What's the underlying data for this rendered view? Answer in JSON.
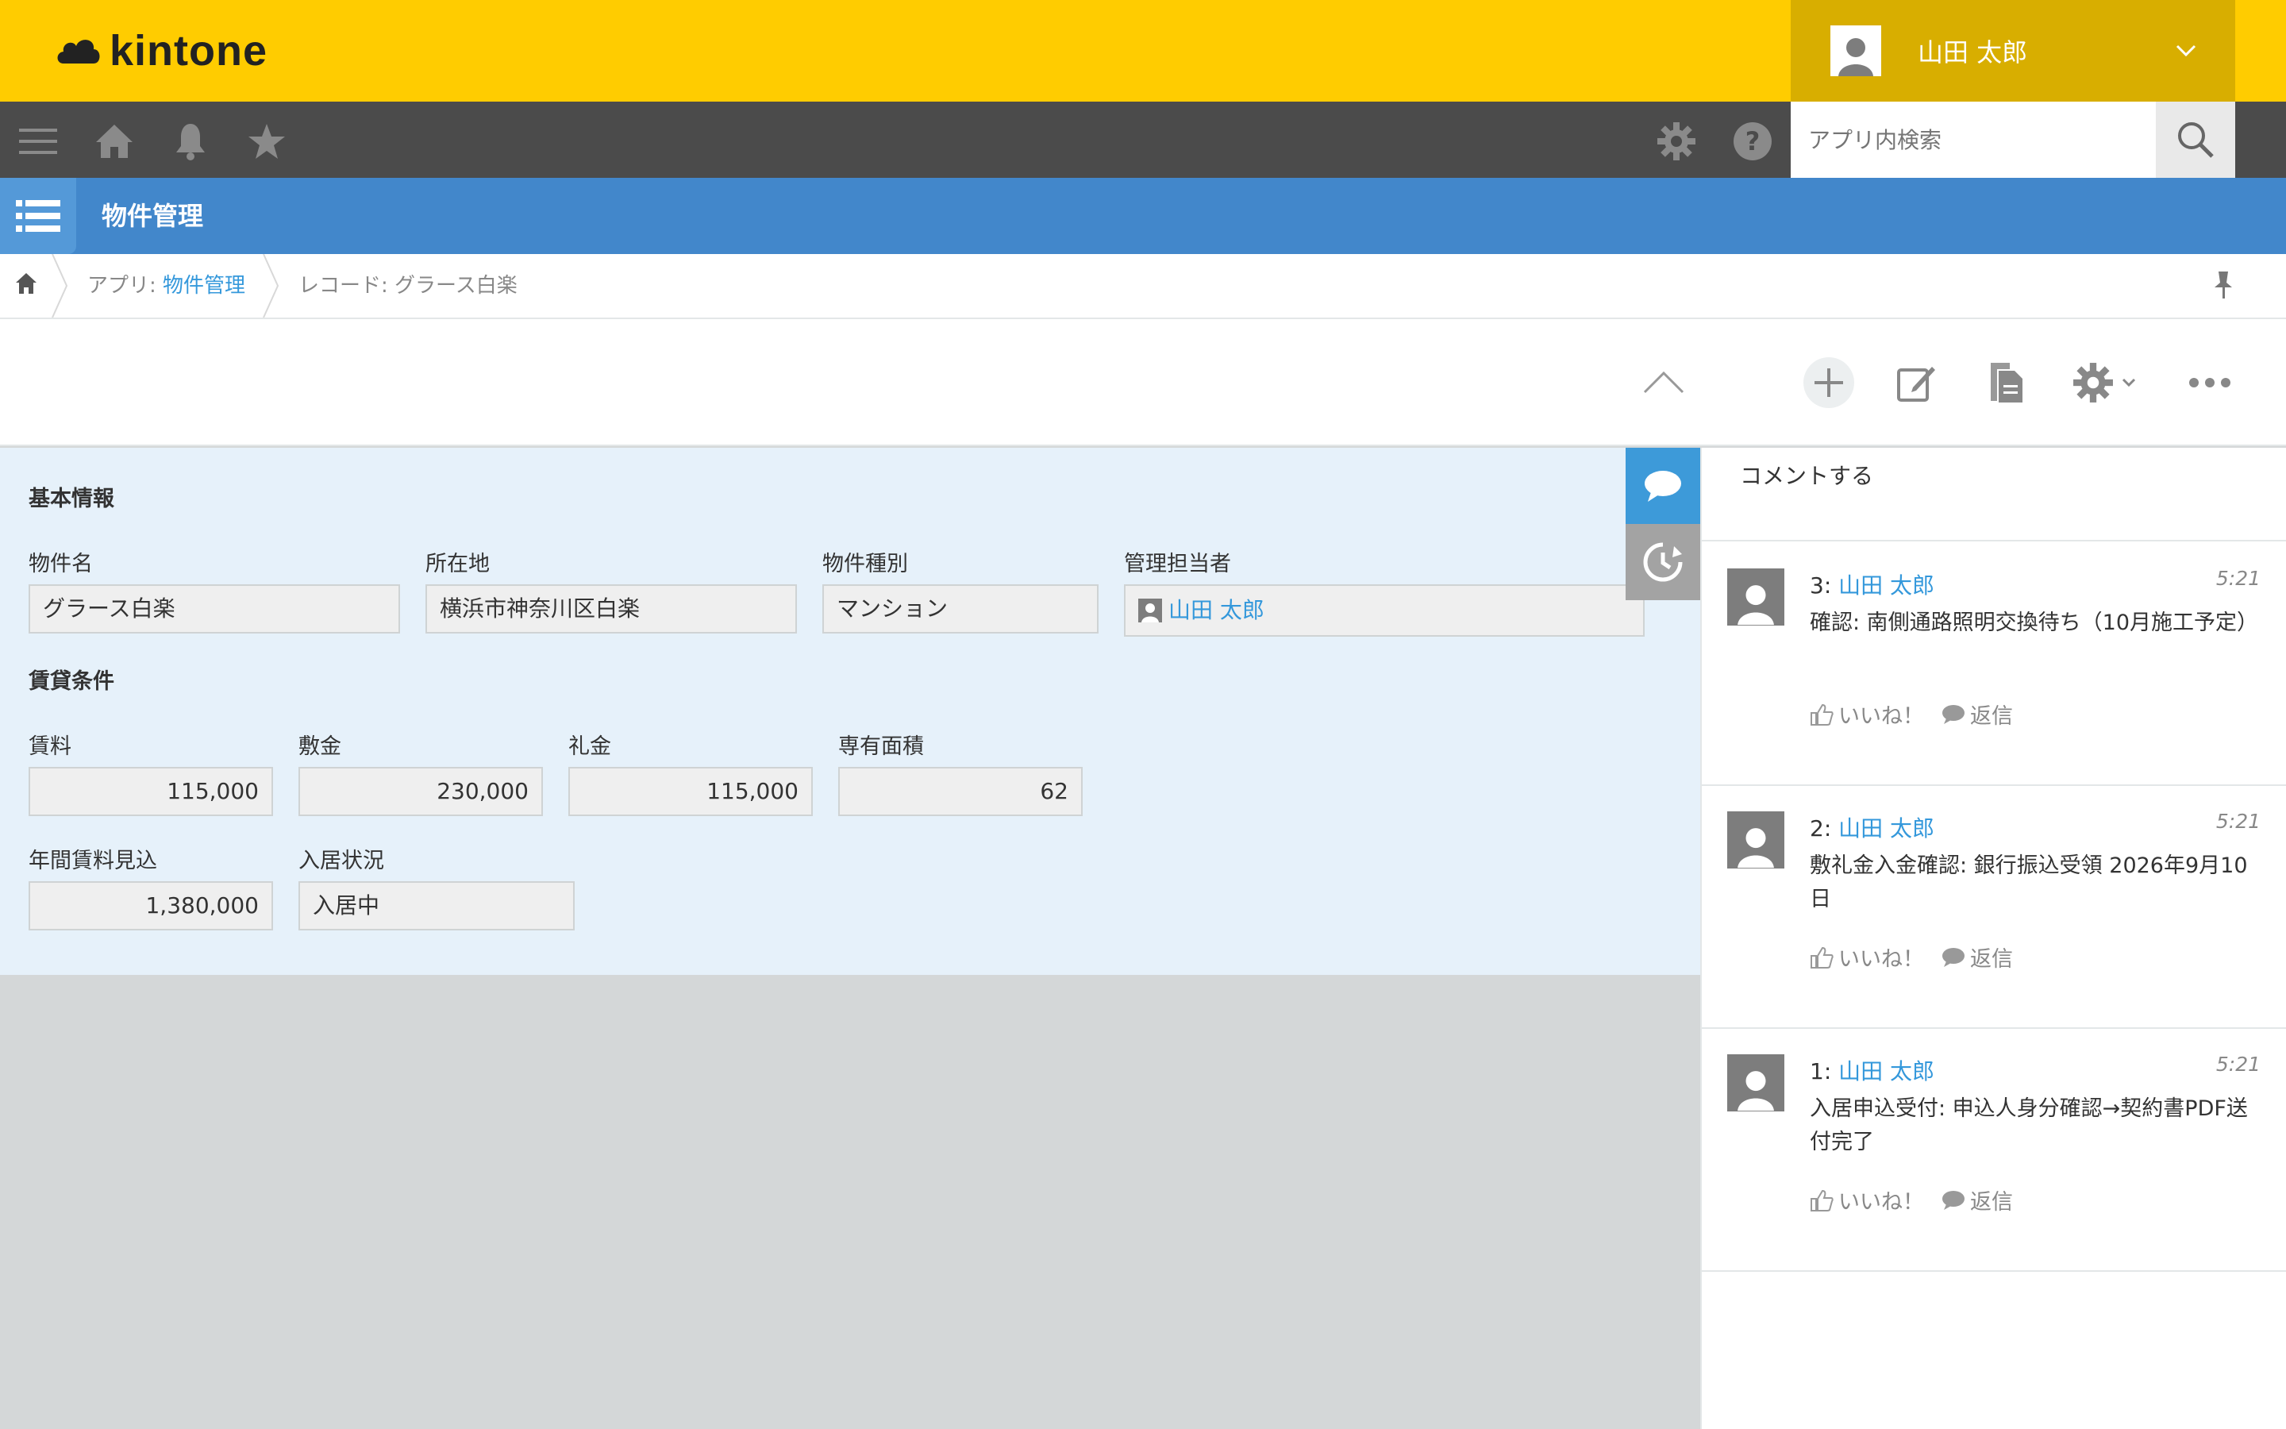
{
  "header": {
    "brand": "kintone",
    "user_name": "山田 太郎"
  },
  "nav": {
    "search_placeholder": "アプリ内検索"
  },
  "app": {
    "title": "物件管理"
  },
  "breadcrumb": {
    "app_prefix": "アプリ: ",
    "app_name": "物件管理",
    "record": "レコード: グラース白楽"
  },
  "form": {
    "section_basic": "基本情報",
    "property_name_label": "物件名",
    "property_name": "グラース白楽",
    "address_label": "所在地",
    "address": "横浜市神奈川区白楽",
    "type_label": "物件種別",
    "type": "マンション",
    "manager_label": "管理担当者",
    "manager": "山田 太郎",
    "section_lease": "賃貸条件",
    "rent_label": "賃料",
    "rent": "115,000",
    "deposit_label": "敷金",
    "deposit": "230,000",
    "key_money_label": "礼金",
    "key_money": "115,000",
    "area_label": "専有面積",
    "area": "62",
    "annual_rent_label": "年間賃料見込",
    "annual_rent": "1,380,000",
    "occupancy_label": "入居状況",
    "occupancy": "入居中"
  },
  "comments": {
    "compose_label": "コメントする",
    "like_label": "いいね！",
    "reply_label": "返信",
    "items": [
      {
        "num": "3:",
        "user": "山田 太郎",
        "time": "5:21",
        "body": "確認: 南側通路照明交換待ち（10月施工予定）"
      },
      {
        "num": "2:",
        "user": "山田 太郎",
        "time": "5:21",
        "body": "敷礼金入金確認: 銀行振込受領 2026年9月10日"
      },
      {
        "num": "1:",
        "user": "山田 太郎",
        "time": "5:21",
        "body": "入居申込受付: 申込人身分確認→契約書PDF送付完了"
      }
    ]
  },
  "colors": {
    "header": "#ffcc00",
    "nav": "#4b4b4b",
    "appbar": "#4287cb",
    "link": "#3498db",
    "form_bg": "#e6f1fa"
  }
}
